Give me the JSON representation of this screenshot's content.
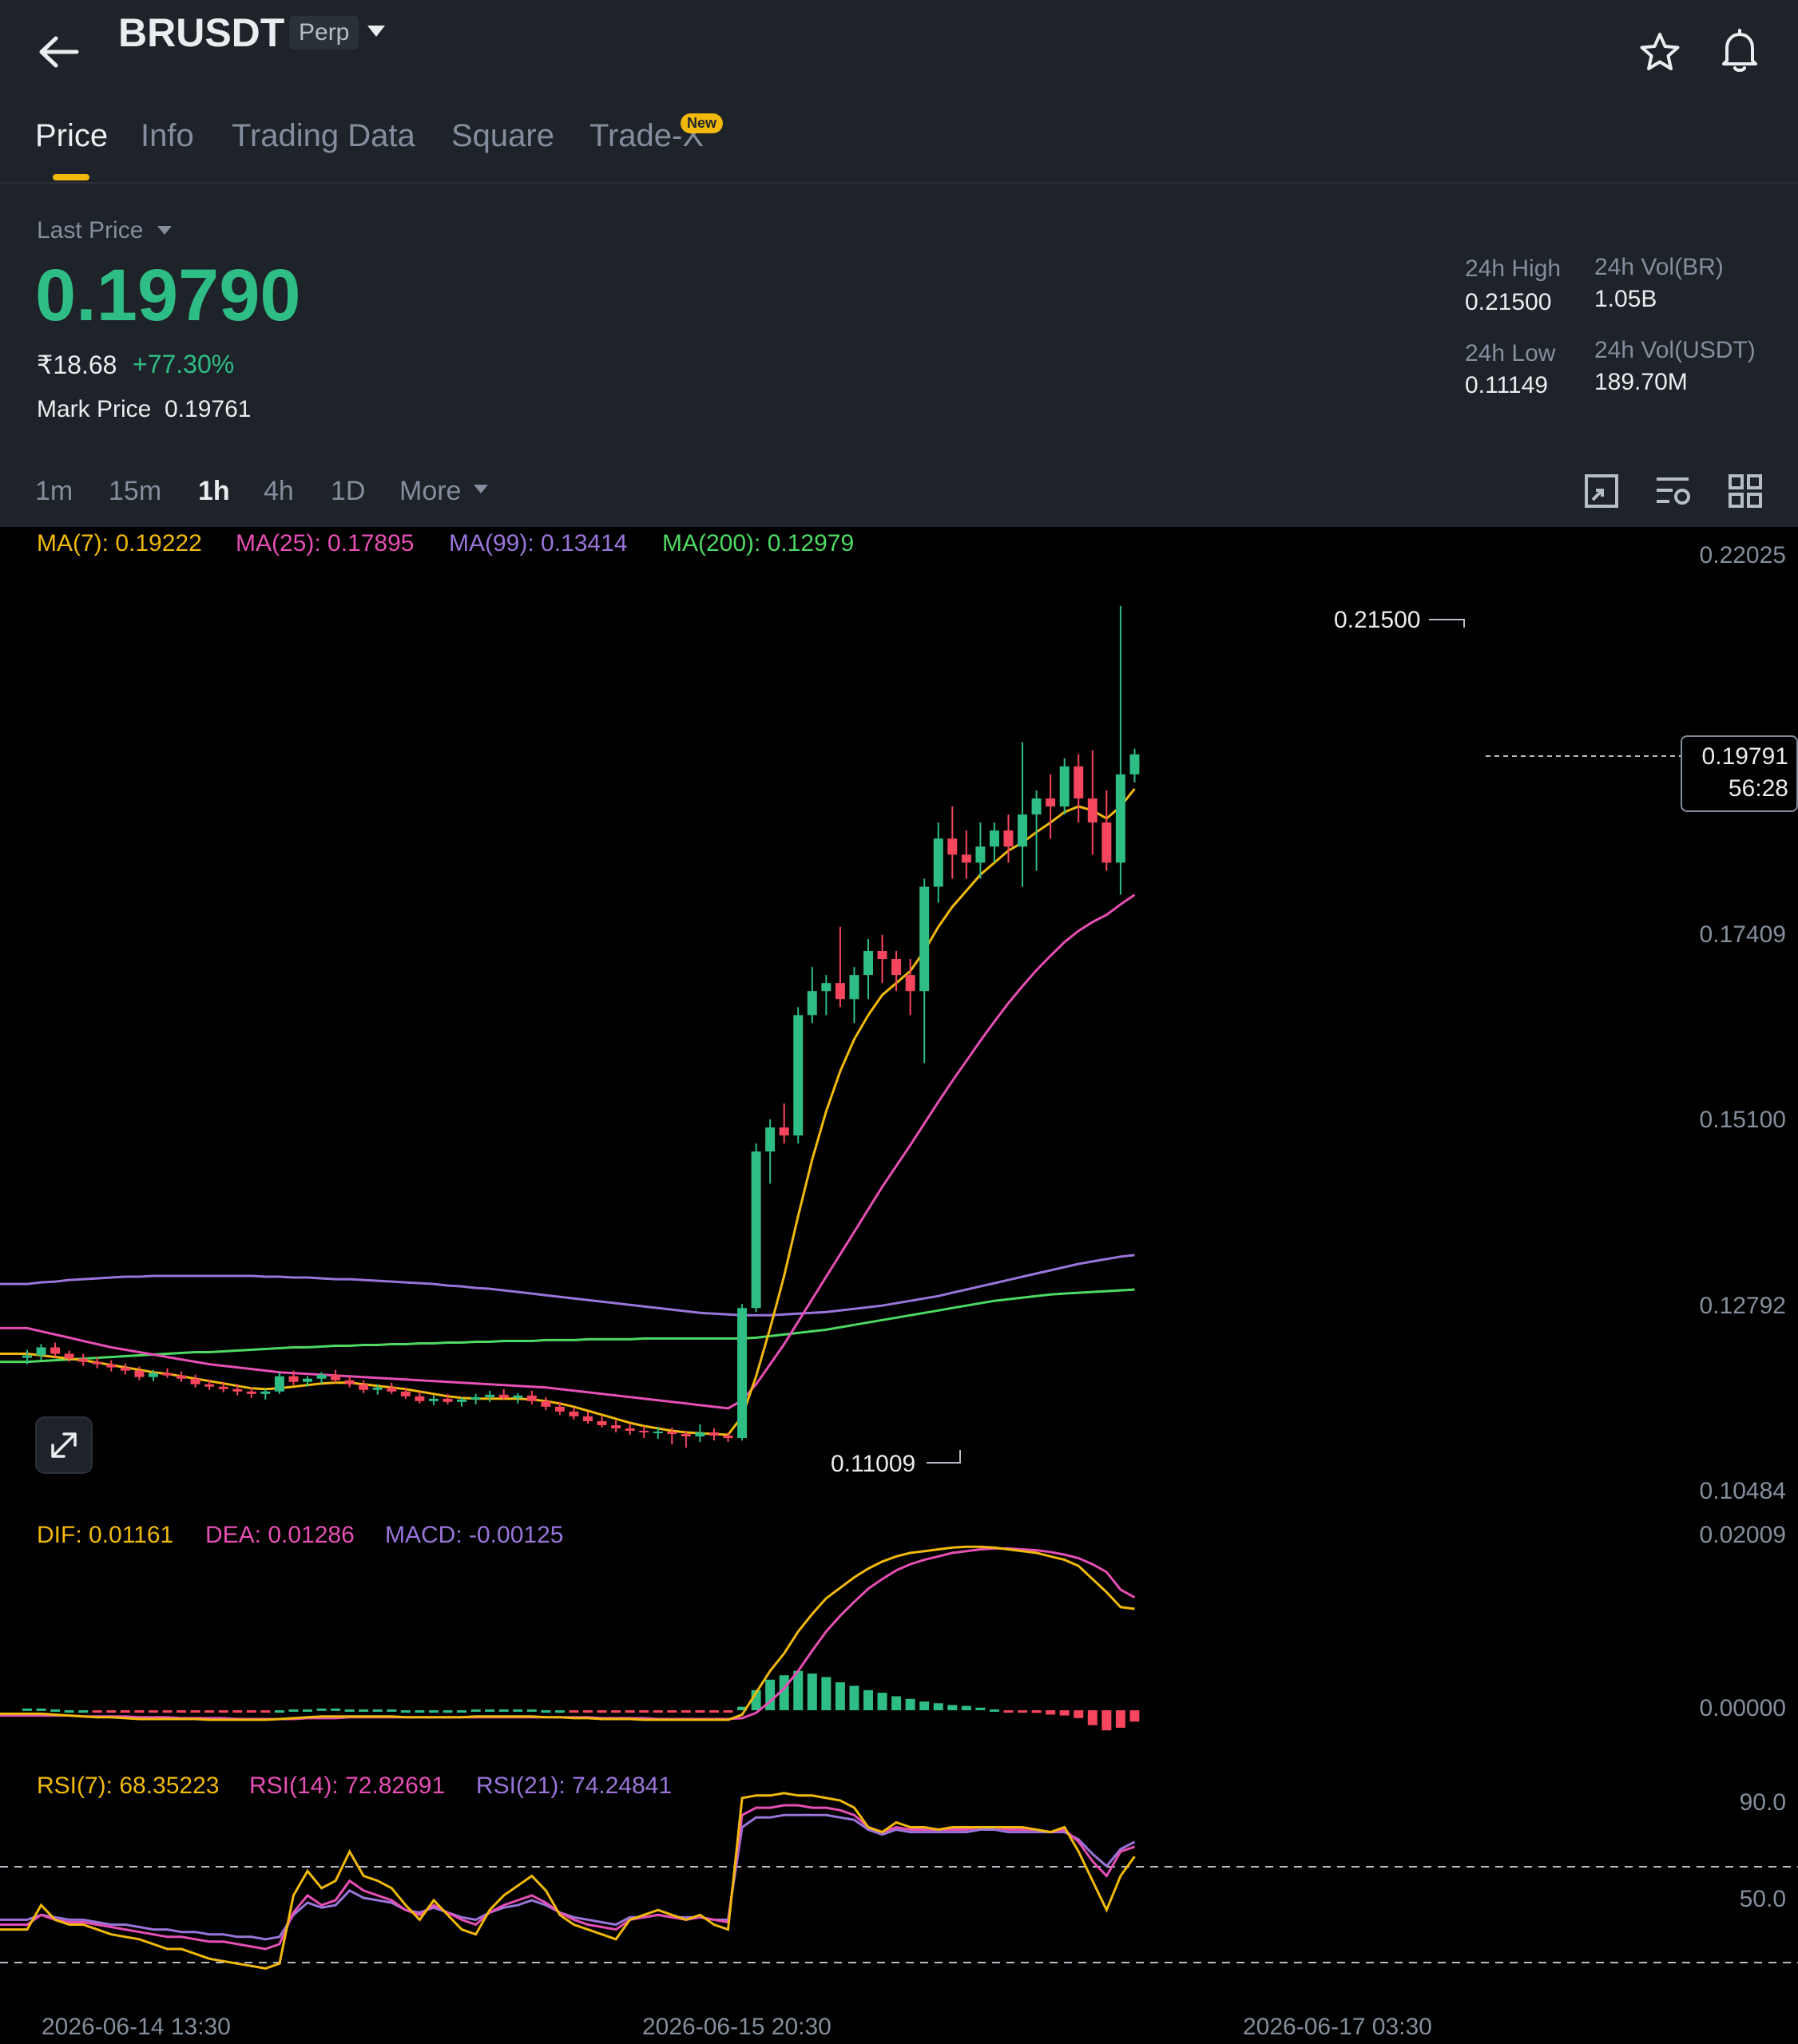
{
  "header": {
    "symbol": "BRUSDT",
    "contract_type": "Perp",
    "tabs": [
      {
        "label": "Price"
      },
      {
        "label": "Info"
      },
      {
        "label": "Trading Data"
      },
      {
        "label": "Square"
      },
      {
        "label": "Trade-X",
        "badge": "New"
      }
    ],
    "active_tab": "Price"
  },
  "ticker": {
    "price_type_label": "Last Price",
    "last_price": "0.19790",
    "inr_price": "₹18.68",
    "change_pct": "+77.30%",
    "mark_price_label": "Mark Price",
    "mark_price": "0.19761",
    "high_label": "24h High",
    "high": "0.21500",
    "low_label": "24h Low",
    "low": "0.11149",
    "vol_base_label": "24h Vol(BR)",
    "vol_base": "1.05B",
    "vol_quote_label": "24h Vol(USDT)",
    "vol_quote": "189.70M"
  },
  "intervals": [
    "1m",
    "15m",
    "1h",
    "4h",
    "1D"
  ],
  "active_interval": "1h",
  "more_label": "More",
  "icons": {
    "back": "back-arrow-icon",
    "favorite": "star-icon",
    "alert": "bell-icon",
    "chart_type": "chart-type-icon",
    "indicator_settings": "indicator-settings-icon",
    "layout": "grid-layout-icon",
    "expand": "expand-icon"
  },
  "colors": {
    "up": "#2ebd85",
    "down": "#f6465d",
    "accent": "#f0b90b",
    "ma7": "#f0b90b",
    "ma25": "#e64fb5",
    "ma99": "#9a75d9",
    "ma200": "#4cd964"
  },
  "ma_legend": [
    {
      "label": "MA(7): 0.19222",
      "color": "#f0b90b"
    },
    {
      "label": "MA(25): 0.17895",
      "color": "#e64fb5"
    },
    {
      "label": "MA(99): 0.13414",
      "color": "#9a75d9"
    },
    {
      "label": "MA(200): 0.12979",
      "color": "#4cd964"
    }
  ],
  "macd_legend": [
    {
      "label": "DIF: 0.01161",
      "color": "#f0b90b"
    },
    {
      "label": "DEA: 0.01286",
      "color": "#e64fb5"
    },
    {
      "label": "MACD: -0.00125",
      "color": "#9a75d9"
    }
  ],
  "rsi_legend": [
    {
      "label": "RSI(7): 68.35223",
      "color": "#f0b90b"
    },
    {
      "label": "RSI(14): 72.82691",
      "color": "#e64fb5"
    },
    {
      "label": "RSI(21): 74.24841",
      "color": "#9a75d9"
    }
  ],
  "chart_data": {
    "type": "candlestick",
    "price_axis_ticks": [
      "0.22025",
      "0.17409",
      "0.15100",
      "0.12792",
      "0.10484"
    ],
    "macd_axis_ticks": [
      "0.02009",
      "0.00000"
    ],
    "rsi_axis_ticks": [
      "90.0",
      "50.0"
    ],
    "time_labels": [
      "2026-06-14 13:30",
      "2026-06-15 20:30",
      "2026-06-17 03:30"
    ],
    "high_marker": "0.21500",
    "low_marker": "0.11009",
    "current_price_tag": "0.19791",
    "countdown": "56:28",
    "candles": [
      [
        0.1213,
        0.1223,
        0.1205,
        0.1216
      ],
      [
        0.1216,
        0.123,
        0.121,
        0.1226
      ],
      [
        0.1226,
        0.1232,
        0.1214,
        0.1218
      ],
      [
        0.1218,
        0.1222,
        0.1208,
        0.1212
      ],
      [
        0.1212,
        0.1218,
        0.1203,
        0.1208
      ],
      [
        0.1208,
        0.1214,
        0.12,
        0.1205
      ],
      [
        0.1205,
        0.121,
        0.1196,
        0.1201
      ],
      [
        0.1201,
        0.1206,
        0.1192,
        0.1197
      ],
      [
        0.1197,
        0.1202,
        0.1185,
        0.1189
      ],
      [
        0.1189,
        0.1198,
        0.1184,
        0.1194
      ],
      [
        0.1194,
        0.12,
        0.1188,
        0.1191
      ],
      [
        0.1191,
        0.1196,
        0.1183,
        0.1187
      ],
      [
        0.1187,
        0.1192,
        0.1176,
        0.118
      ],
      [
        0.118,
        0.1186,
        0.1173,
        0.1177
      ],
      [
        0.1177,
        0.1183,
        0.117,
        0.1174
      ],
      [
        0.1174,
        0.118,
        0.1166,
        0.1171
      ],
      [
        0.1171,
        0.1176,
        0.1163,
        0.1168
      ],
      [
        0.1168,
        0.1174,
        0.1161,
        0.1171
      ],
      [
        0.1171,
        0.1195,
        0.1168,
        0.119
      ],
      [
        0.119,
        0.1197,
        0.1179,
        0.1183
      ],
      [
        0.1183,
        0.119,
        0.1177,
        0.1187
      ],
      [
        0.1187,
        0.1195,
        0.1181,
        0.1192
      ],
      [
        0.1192,
        0.1198,
        0.1182,
        0.1185
      ],
      [
        0.1185,
        0.119,
        0.1176,
        0.118
      ],
      [
        0.118,
        0.1185,
        0.1169,
        0.1173
      ],
      [
        0.1173,
        0.118,
        0.1167,
        0.1176
      ],
      [
        0.1176,
        0.1182,
        0.1168,
        0.1171
      ],
      [
        0.1171,
        0.1176,
        0.1162,
        0.1165
      ],
      [
        0.1165,
        0.1171,
        0.1156,
        0.1159
      ],
      [
        0.1159,
        0.1166,
        0.1154,
        0.1162
      ],
      [
        0.1162,
        0.1168,
        0.1155,
        0.1158
      ],
      [
        0.1158,
        0.1164,
        0.1152,
        0.1161
      ],
      [
        0.1161,
        0.1168,
        0.1155,
        0.1164
      ],
      [
        0.1164,
        0.1172,
        0.1158,
        0.1167
      ],
      [
        0.1167,
        0.1174,
        0.116,
        0.1163
      ],
      [
        0.1163,
        0.1169,
        0.1156,
        0.1166
      ],
      [
        0.1166,
        0.1172,
        0.1155,
        0.1159
      ],
      [
        0.1159,
        0.1164,
        0.1148,
        0.1152
      ],
      [
        0.1152,
        0.1158,
        0.1142,
        0.1146
      ],
      [
        0.1146,
        0.1151,
        0.1136,
        0.114
      ],
      [
        0.114,
        0.1146,
        0.1131,
        0.1134
      ],
      [
        0.1134,
        0.114,
        0.1126,
        0.1129
      ],
      [
        0.1129,
        0.1135,
        0.112,
        0.1125
      ],
      [
        0.1125,
        0.1131,
        0.1117,
        0.1122
      ],
      [
        0.1122,
        0.1128,
        0.1113,
        0.112
      ],
      [
        0.112,
        0.1127,
        0.1112,
        0.1121
      ],
      [
        0.1121,
        0.1126,
        0.1105,
        0.1118
      ],
      [
        0.1118,
        0.1122,
        0.1101,
        0.1115
      ],
      [
        0.1115,
        0.113,
        0.1108,
        0.112
      ],
      [
        0.112,
        0.1125,
        0.111,
        0.1116
      ],
      [
        0.1116,
        0.112,
        0.1108,
        0.1113
      ],
      [
        0.1113,
        0.128,
        0.111,
        0.1275
      ],
      [
        0.1275,
        0.148,
        0.127,
        0.147
      ],
      [
        0.147,
        0.151,
        0.143,
        0.15
      ],
      [
        0.15,
        0.153,
        0.148,
        0.149
      ],
      [
        0.149,
        0.165,
        0.148,
        0.164
      ],
      [
        0.164,
        0.17,
        0.163,
        0.167
      ],
      [
        0.167,
        0.169,
        0.164,
        0.168
      ],
      [
        0.168,
        0.175,
        0.165,
        0.166
      ],
      [
        0.166,
        0.17,
        0.163,
        0.169
      ],
      [
        0.169,
        0.1735,
        0.166,
        0.172
      ],
      [
        0.172,
        0.174,
        0.168,
        0.171
      ],
      [
        0.171,
        0.172,
        0.167,
        0.169
      ],
      [
        0.169,
        0.171,
        0.164,
        0.167
      ],
      [
        0.167,
        0.181,
        0.158,
        0.18
      ],
      [
        0.18,
        0.188,
        0.178,
        0.186
      ],
      [
        0.186,
        0.19,
        0.181,
        0.184
      ],
      [
        0.184,
        0.187,
        0.181,
        0.183
      ],
      [
        0.183,
        0.188,
        0.181,
        0.185
      ],
      [
        0.185,
        0.188,
        0.183,
        0.187
      ],
      [
        0.187,
        0.189,
        0.183,
        0.185
      ],
      [
        0.185,
        0.198,
        0.18,
        0.189
      ],
      [
        0.189,
        0.192,
        0.182,
        0.191
      ],
      [
        0.191,
        0.194,
        0.186,
        0.19
      ],
      [
        0.19,
        0.196,
        0.189,
        0.195
      ],
      [
        0.195,
        0.1965,
        0.188,
        0.191
      ],
      [
        0.191,
        0.197,
        0.184,
        0.188
      ],
      [
        0.188,
        0.192,
        0.182,
        0.183
      ],
      [
        0.183,
        0.215,
        0.179,
        0.194
      ],
      [
        0.194,
        0.1972,
        0.193,
        0.1965
      ]
    ],
    "ma7": [
      0.1218,
      0.1216,
      0.1214,
      0.1212,
      0.121,
      0.1207,
      0.1204,
      0.1201,
      0.1198,
      0.1195,
      0.1193,
      0.119,
      0.1187,
      0.1184,
      0.1181,
      0.1178,
      0.1175,
      0.1174,
      0.1175,
      0.1177,
      0.1179,
      0.1181,
      0.1182,
      0.1182,
      0.118,
      0.1178,
      0.1176,
      0.1174,
      0.1171,
      0.1168,
      0.1165,
      0.1163,
      0.1162,
      0.1162,
      0.1162,
      0.1162,
      0.1161,
      0.1159,
      0.1156,
      0.1152,
      0.1147,
      0.1142,
      0.1137,
      0.1132,
      0.1128,
      0.1125,
      0.1122,
      0.112,
      0.1119,
      0.1118,
      0.1117,
      0.114,
      0.119,
      0.125,
      0.1315,
      0.139,
      0.146,
      0.152,
      0.157,
      0.161,
      0.164,
      0.1665,
      0.168,
      0.1695,
      0.172,
      0.175,
      0.1775,
      0.1795,
      0.1815,
      0.183,
      0.1845,
      0.1855,
      0.1868,
      0.188,
      0.1893,
      0.19,
      0.1895,
      0.1885,
      0.19,
      0.1922
    ],
    "ma25": [
      0.125,
      0.1246,
      0.1242,
      0.1238,
      0.1234,
      0.123,
      0.1226,
      0.1223,
      0.122,
      0.1217,
      0.1214,
      0.1211,
      0.1208,
      0.1205,
      0.1203,
      0.1201,
      0.1199,
      0.1197,
      0.1195,
      0.1194,
      0.1193,
      0.1192,
      0.1191,
      0.119,
      0.1189,
      0.1188,
      0.1187,
      0.1186,
      0.1185,
      0.1184,
      0.1183,
      0.1182,
      0.1181,
      0.118,
      0.1179,
      0.1178,
      0.1177,
      0.1176,
      0.1174,
      0.1172,
      0.117,
      0.1168,
      0.1166,
      0.1164,
      0.1162,
      0.116,
      0.1158,
      0.1156,
      0.1154,
      0.1152,
      0.115,
      0.116,
      0.118,
      0.1205,
      0.123,
      0.1258,
      0.1286,
      0.1314,
      0.1342,
      0.137,
      0.1398,
      0.1426,
      0.1452,
      0.1478,
      0.1505,
      0.1532,
      0.1558,
      0.1583,
      0.1608,
      0.1632,
      0.1655,
      0.1676,
      0.1696,
      0.1714,
      0.1731,
      0.1745,
      0.1756,
      0.1765,
      0.1778,
      0.179
    ],
    "ma99": [
      0.1305,
      0.1307,
      0.1308,
      0.131,
      0.1311,
      0.1312,
      0.1313,
      0.1314,
      0.1314,
      0.1315,
      0.1315,
      0.1315,
      0.1315,
      0.1315,
      0.1315,
      0.1315,
      0.1315,
      0.1314,
      0.1314,
      0.1313,
      0.1313,
      0.1312,
      0.1311,
      0.1311,
      0.131,
      0.1309,
      0.1308,
      0.1307,
      0.1306,
      0.1305,
      0.1303,
      0.1302,
      0.13,
      0.1299,
      0.1297,
      0.1295,
      0.1293,
      0.1291,
      0.1289,
      0.1287,
      0.1285,
      0.1283,
      0.1281,
      0.1279,
      0.1277,
      0.1275,
      0.1273,
      0.1271,
      0.1269,
      0.1268,
      0.1267,
      0.1266,
      0.1266,
      0.1266,
      0.1267,
      0.1268,
      0.1269,
      0.127,
      0.1272,
      0.1274,
      0.1276,
      0.1278,
      0.1281,
      0.1284,
      0.1287,
      0.129,
      0.1294,
      0.1298,
      0.1302,
      0.1306,
      0.131,
      0.1314,
      0.1318,
      0.1322,
      0.1326,
      0.133,
      0.1333,
      0.1336,
      0.1339,
      0.1341
    ],
    "ma200": [
      0.1208,
      0.1209,
      0.121,
      0.1211,
      0.1212,
      0.1213,
      0.1214,
      0.1215,
      0.1216,
      0.1217,
      0.1218,
      0.1219,
      0.122,
      0.122,
      0.1221,
      0.1222,
      0.1223,
      0.1224,
      0.1225,
      0.1226,
      0.1226,
      0.1227,
      0.1228,
      0.1228,
      0.1229,
      0.1229,
      0.123,
      0.123,
      0.1231,
      0.1231,
      0.1232,
      0.1232,
      0.1233,
      0.1233,
      0.1234,
      0.1234,
      0.1234,
      0.1235,
      0.1235,
      0.1235,
      0.1236,
      0.1236,
      0.1236,
      0.1236,
      0.1237,
      0.1237,
      0.1237,
      0.1237,
      0.1237,
      0.1237,
      0.1237,
      0.1237,
      0.1238,
      0.124,
      0.1242,
      0.1244,
      0.1246,
      0.1248,
      0.1251,
      0.1254,
      0.1257,
      0.126,
      0.1263,
      0.1266,
      0.1269,
      0.1272,
      0.1275,
      0.1278,
      0.1281,
      0.1284,
      0.1286,
      0.1288,
      0.129,
      0.1292,
      0.1293,
      0.1294,
      0.1295,
      0.1296,
      0.1297,
      0.1298
    ],
    "macd_dif": [
      -0.0004,
      -0.0004,
      -0.0005,
      -0.0006,
      -0.0007,
      -0.0008,
      -0.0008,
      -0.0009,
      -0.001,
      -0.001,
      -0.001,
      -0.001,
      -0.001,
      -0.0011,
      -0.0011,
      -0.0011,
      -0.0011,
      -0.0011,
      -0.001,
      -0.0009,
      -0.0008,
      -0.0007,
      -0.0007,
      -0.0007,
      -0.0007,
      -0.0007,
      -0.0007,
      -0.0008,
      -0.0008,
      -0.0008,
      -0.0008,
      -0.0008,
      -0.0007,
      -0.0007,
      -0.0007,
      -0.0007,
      -0.0007,
      -0.0008,
      -0.0008,
      -0.0009,
      -0.0009,
      -0.001,
      -0.001,
      -0.001,
      -0.0011,
      -0.0011,
      -0.0011,
      -0.0011,
      -0.0011,
      -0.0011,
      -0.0011,
      -0.0005,
      0.002,
      0.0045,
      0.0065,
      0.009,
      0.011,
      0.0128,
      0.014,
      0.0152,
      0.0162,
      0.017,
      0.0176,
      0.018,
      0.0182,
      0.0184,
      0.0186,
      0.0187,
      0.0187,
      0.0186,
      0.0184,
      0.0182,
      0.018,
      0.0176,
      0.0172,
      0.0165,
      0.015,
      0.0135,
      0.0118,
      0.0116
    ],
    "macd_dea": [
      -0.0006,
      -0.0006,
      -0.0006,
      -0.0006,
      -0.0007,
      -0.0007,
      -0.0007,
      -0.0007,
      -0.0008,
      -0.0008,
      -0.0008,
      -0.0009,
      -0.0009,
      -0.0009,
      -0.0009,
      -0.001,
      -0.001,
      -0.001,
      -0.001,
      -0.001,
      -0.0009,
      -0.0009,
      -0.0009,
      -0.0008,
      -0.0008,
      -0.0008,
      -0.0008,
      -0.0008,
      -0.0008,
      -0.0008,
      -0.0008,
      -0.0008,
      -0.0008,
      -0.0008,
      -0.0008,
      -0.0008,
      -0.0008,
      -0.0008,
      -0.0008,
      -0.0008,
      -0.0008,
      -0.0009,
      -0.0009,
      -0.0009,
      -0.0009,
      -0.001,
      -0.001,
      -0.001,
      -0.001,
      -0.001,
      -0.001,
      -0.0009,
      -0.0003,
      0.001,
      0.0025,
      0.0045,
      0.0068,
      0.009,
      0.0108,
      0.0124,
      0.0139,
      0.015,
      0.016,
      0.0167,
      0.0172,
      0.0176,
      0.018,
      0.0182,
      0.0184,
      0.0185,
      0.0185,
      0.0184,
      0.0183,
      0.0181,
      0.0178,
      0.0174,
      0.0167,
      0.0158,
      0.0138,
      0.0129
    ],
    "macd_hist": [
      0.0002,
      0.0002,
      0.0001,
      0.0,
      0.0,
      -0.0001,
      -0.0001,
      -0.0002,
      -0.0002,
      -0.0002,
      -0.0002,
      -0.0001,
      -0.0001,
      -0.0002,
      -0.0002,
      -0.0001,
      -0.0001,
      -0.0001,
      0.0,
      0.0001,
      0.0001,
      0.0002,
      0.0002,
      0.0001,
      0.0001,
      0.0001,
      0.0001,
      0.0,
      0.0,
      0.0,
      0.0,
      0.0,
      0.0001,
      0.0001,
      0.0001,
      0.0001,
      0.0001,
      0.0,
      0.0,
      -0.0001,
      -0.0001,
      -0.0001,
      -0.0001,
      -0.0001,
      -0.0002,
      -0.0001,
      -0.0001,
      -0.0001,
      -0.0001,
      -0.0001,
      -0.0001,
      0.0004,
      0.0023,
      0.0035,
      0.004,
      0.0045,
      0.0042,
      0.0038,
      0.0032,
      0.0028,
      0.0023,
      0.002,
      0.0016,
      0.0013,
      0.001,
      0.0008,
      0.0006,
      0.0005,
      0.0003,
      0.0001,
      -0.0001,
      -0.0002,
      -0.0003,
      -0.0005,
      -0.0006,
      -0.0009,
      -0.0017,
      -0.0023,
      -0.002,
      -0.0013
    ],
    "rsi7": [
      38,
      48,
      42,
      40,
      40,
      38,
      36,
      35,
      34,
      32,
      30,
      30,
      28,
      26,
      25,
      24,
      23,
      22,
      24,
      52,
      62,
      55,
      58,
      70,
      60,
      58,
      55,
      48,
      42,
      50,
      44,
      38,
      36,
      46,
      52,
      56,
      60,
      54,
      44,
      40,
      38,
      36,
      34,
      42,
      44,
      46,
      44,
      42,
      44,
      40,
      38,
      92,
      93,
      93,
      94,
      93,
      93,
      92,
      91,
      88,
      80,
      78,
      82,
      80,
      80,
      79,
      80,
      80,
      80,
      80,
      80,
      80,
      79,
      78,
      80,
      70,
      58,
      46,
      60,
      68
    ],
    "rsi14": [
      40,
      44,
      42,
      41,
      41,
      40,
      39,
      38,
      37,
      36,
      35,
      35,
      34,
      33,
      33,
      32,
      31,
      30,
      32,
      45,
      52,
      48,
      50,
      58,
      54,
      52,
      50,
      46,
      44,
      48,
      45,
      42,
      40,
      45,
      48,
      50,
      52,
      49,
      45,
      42,
      40,
      39,
      38,
      42,
      43,
      44,
      43,
      42,
      43,
      42,
      41,
      85,
      88,
      88,
      89,
      89,
      88,
      88,
      87,
      85,
      80,
      78,
      80,
      79,
      79,
      79,
      79,
      79,
      80,
      80,
      79,
      79,
      79,
      78,
      79,
      74,
      66,
      60,
      70,
      72
    ],
    "rsi21": [
      42,
      44,
      43,
      42,
      42,
      41,
      40,
      40,
      39,
      38,
      38,
      37,
      37,
      36,
      36,
      35,
      35,
      34,
      35,
      44,
      49,
      47,
      48,
      54,
      51,
      50,
      49,
      46,
      45,
      47,
      45,
      43,
      42,
      45,
      47,
      48,
      50,
      48,
      45,
      43,
      42,
      41,
      40,
      43,
      43,
      44,
      43,
      43,
      43,
      42,
      42,
      80,
      84,
      84,
      85,
      85,
      85,
      85,
      84,
      83,
      79,
      77,
      79,
      78,
      78,
      78,
      78,
      78,
      79,
      79,
      78,
      78,
      78,
      78,
      78,
      75,
      69,
      64,
      71,
      74
    ]
  }
}
